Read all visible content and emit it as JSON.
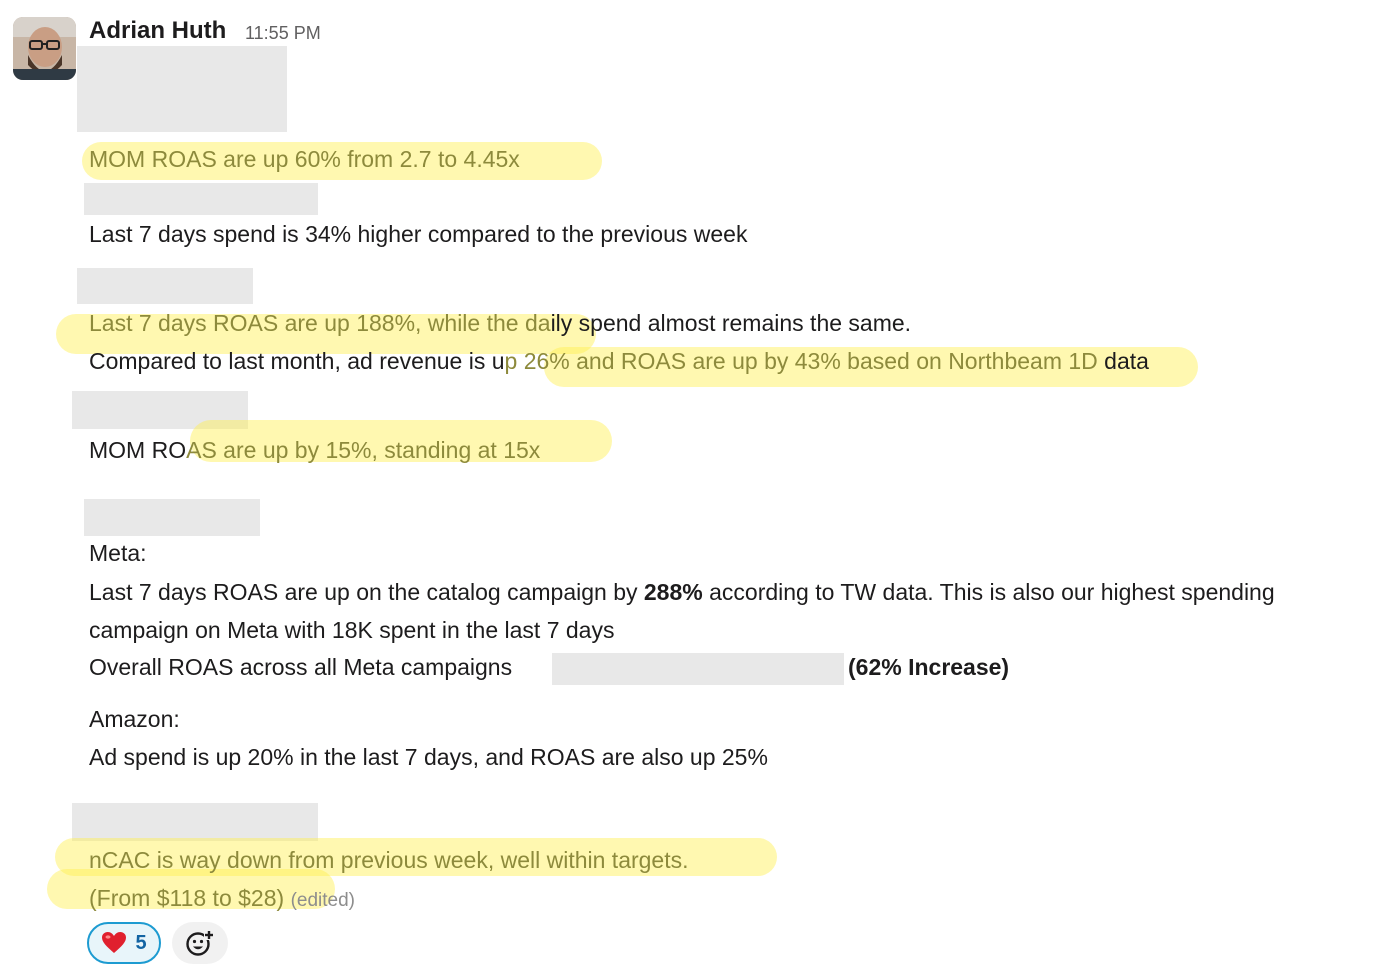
{
  "message": {
    "author": "Adrian Huth",
    "timestamp": "11:55 PM",
    "lines": {
      "l1": "MOM ROAS are up 60% from 2.7 to 4.45x",
      "l2": "Last 7 days spend is 34% higher compared to the previous week",
      "l3a": "Last 7 days ROAS are up 188%, while the da",
      "l3b": "ily spend almost remains the same.",
      "l4a": "Compared to last month, ad revenue is u",
      "l4b": "p 26% and ROAS are up by 43% based on Northbeam 1D",
      "l4c": " data",
      "l5a": "MOM RO",
      "l5b": "AS are up by 15%, standing at 15x",
      "l6": "Meta:",
      "l7a": "Last 7 days ROAS are up on the catalog campaign by ",
      "l7b": "288%",
      "l7c": " according to TW data. This is also our highest spending",
      "l8": "campaign on Meta with 18K spent in the last 7 days",
      "l9a": "Overall ROAS across all Meta campaigns",
      "l9b": "(62% Increase)",
      "l10": "Amazon:",
      "l11": "Ad spend is up 20% in the last 7 days, and ROAS are also up 25%",
      "l12": "nCAC is way down from previous week, well within targets.",
      "l13": "(From $118 to $28)",
      "edited": "(edited)"
    },
    "reactions": [
      {
        "icon": "heart-icon",
        "emoji": "❤️",
        "count": "5"
      }
    ],
    "add_reaction_icon": "add-reaction-icon"
  },
  "colors": {
    "highlight": "#fff050",
    "reaction_border": "#1d9bd1",
    "text": "#1d1c1d",
    "highlighted_text": "#8d8a3c"
  }
}
